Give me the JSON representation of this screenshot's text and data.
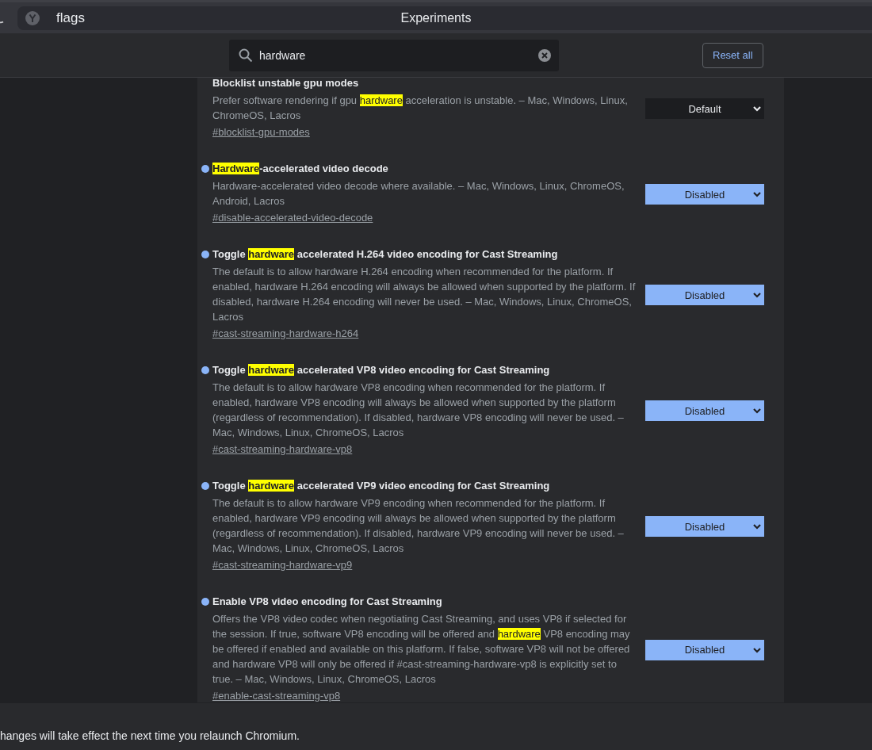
{
  "toolbar": {
    "address": "flags",
    "title": "Experiments"
  },
  "search": {
    "value": "hardware"
  },
  "reset_button": "Reset all",
  "flags": [
    {
      "modified": false,
      "title": [
        {
          "text": "Blocklist unstable gpu modes",
          "highlight": false
        }
      ],
      "description": [
        {
          "text": "Prefer software rendering if gpu ",
          "highlight": false
        },
        {
          "text": "hardware",
          "highlight": true
        },
        {
          "text": " acceleration is unstable. – Mac, Windows, Linux, ChromeOS, Lacros",
          "highlight": false
        }
      ],
      "link": "#blocklist-gpu-modes",
      "value": "Default"
    },
    {
      "modified": true,
      "title": [
        {
          "text": "Hardware",
          "highlight": true
        },
        {
          "text": "-accelerated video decode",
          "highlight": false
        }
      ],
      "description": [
        {
          "text": "Hardware-accelerated video decode where available. – Mac, Windows, Linux, ChromeOS, Android, Lacros",
          "highlight": false
        }
      ],
      "link": "#disable-accelerated-video-decode",
      "value": "Disabled"
    },
    {
      "modified": true,
      "title": [
        {
          "text": "Toggle ",
          "highlight": false
        },
        {
          "text": "hardware",
          "highlight": true
        },
        {
          "text": " accelerated H.264 video encoding for Cast Streaming",
          "highlight": false
        }
      ],
      "description": [
        {
          "text": "The default is to allow hardware H.264 encoding when recommended for the platform. If enabled, hardware H.264 encoding will always be allowed when supported by the platform. If disabled, hardware H.264 encoding will never be used. – Mac, Windows, Linux, ChromeOS, Lacros",
          "highlight": false
        }
      ],
      "link": "#cast-streaming-hardware-h264",
      "value": "Disabled"
    },
    {
      "modified": true,
      "title": [
        {
          "text": "Toggle ",
          "highlight": false
        },
        {
          "text": "hardware",
          "highlight": true
        },
        {
          "text": " accelerated VP8 video encoding for Cast Streaming",
          "highlight": false
        }
      ],
      "description": [
        {
          "text": "The default is to allow hardware VP8 encoding when recommended for the platform. If enabled, hardware VP8 encoding will always be allowed when supported by the platform (regardless of recommendation). If disabled, hardware VP8 encoding will never be used. – Mac, Windows, Linux, ChromeOS, Lacros",
          "highlight": false
        }
      ],
      "link": "#cast-streaming-hardware-vp8",
      "value": "Disabled"
    },
    {
      "modified": true,
      "title": [
        {
          "text": "Toggle ",
          "highlight": false
        },
        {
          "text": "hardware",
          "highlight": true
        },
        {
          "text": " accelerated VP9 video encoding for Cast Streaming",
          "highlight": false
        }
      ],
      "description": [
        {
          "text": "The default is to allow hardware VP9 encoding when recommended for the platform. If enabled, hardware VP9 encoding will always be allowed when supported by the platform (regardless of recommendation). If disabled, hardware VP9 encoding will never be used. – Mac, Windows, Linux, ChromeOS, Lacros",
          "highlight": false
        }
      ],
      "link": "#cast-streaming-hardware-vp9",
      "value": "Disabled"
    },
    {
      "modified": true,
      "title": [
        {
          "text": "Enable VP8 video encoding for Cast Streaming",
          "highlight": false
        }
      ],
      "description": [
        {
          "text": "Offers the VP8 video codec when negotiating Cast Streaming, and uses VP8 if selected for the session. If true, software VP8 encoding will be offered and ",
          "highlight": false
        },
        {
          "text": "hardware",
          "highlight": true
        },
        {
          "text": " VP8 encoding may be offered if enabled and available on this platform. If false, software VP8 will not be offered and hardware VP8 will only be offered if #cast-streaming-hardware-vp8 is explicitly set to true. – Mac, Windows, Linux, ChromeOS, Lacros",
          "highlight": false
        }
      ],
      "link": "#enable-cast-streaming-vp8",
      "value": "Disabled"
    }
  ],
  "banner": "hanges will take effect the next time you relaunch Chromium."
}
